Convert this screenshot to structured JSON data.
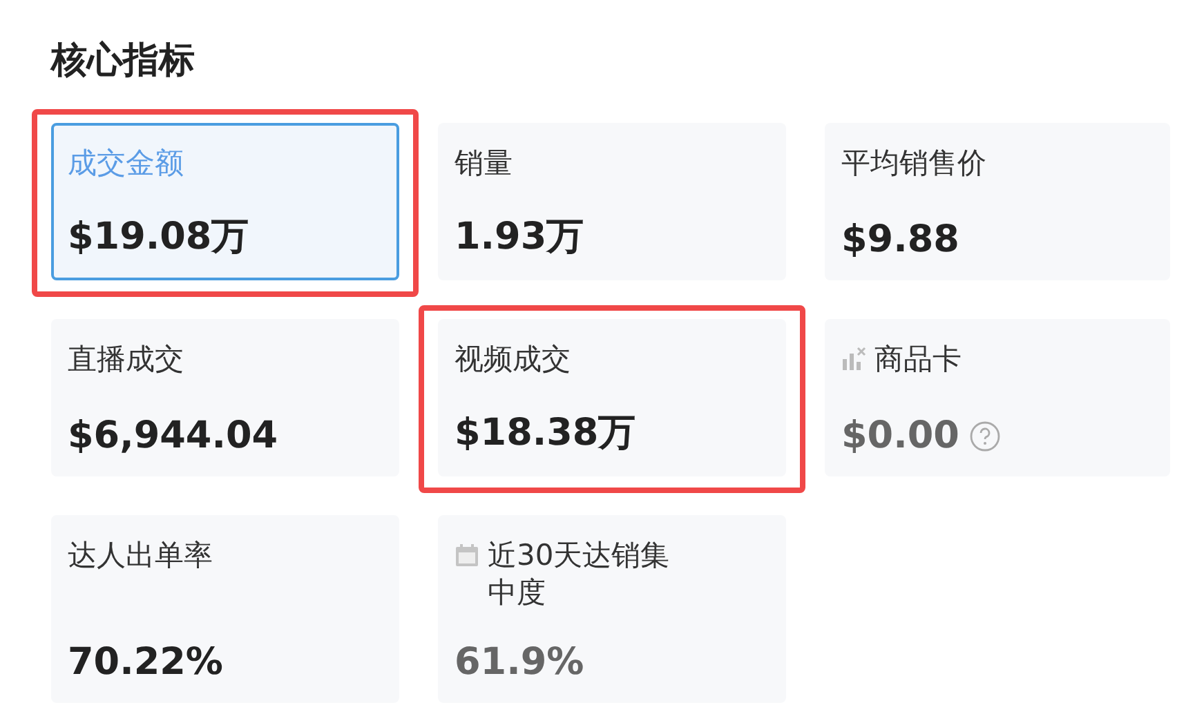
{
  "title": "核心指标",
  "cards": [
    {
      "label": "成交金额",
      "value": "$19.08万",
      "selected": true,
      "highlighted": true,
      "kind": "plain",
      "dimmed": false,
      "help": false
    },
    {
      "label": "销量",
      "value": "1.93万",
      "selected": false,
      "highlighted": false,
      "kind": "plain",
      "dimmed": false,
      "help": false
    },
    {
      "label": "平均销售价",
      "value": "$9.88",
      "selected": false,
      "highlighted": false,
      "kind": "plain",
      "dimmed": false,
      "help": false
    },
    {
      "label": "直播成交",
      "value": "$6,944.04",
      "selected": false,
      "highlighted": false,
      "kind": "plain",
      "dimmed": false,
      "help": false
    },
    {
      "label": "视频成交",
      "value": "$18.38万",
      "selected": false,
      "highlighted": true,
      "kind": "plain",
      "dimmed": false,
      "help": false
    },
    {
      "label": "商品卡",
      "value": "$0.00",
      "selected": false,
      "highlighted": false,
      "kind": "chart",
      "dimmed": true,
      "help": true
    },
    {
      "label": "达人出单率",
      "value": "70.22%",
      "selected": false,
      "highlighted": false,
      "kind": "plain",
      "dimmed": false,
      "help": false
    },
    {
      "label": "近30天达销集中度",
      "value": "61.9%",
      "selected": false,
      "highlighted": false,
      "kind": "calendar",
      "dimmed": true,
      "help": false
    }
  ]
}
